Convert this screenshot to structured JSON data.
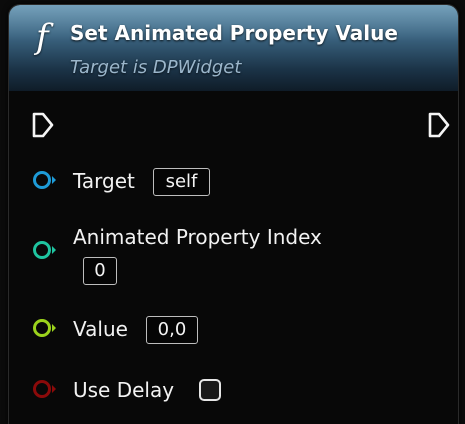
{
  "node": {
    "icon": "function-icon",
    "icon_glyph": "f",
    "title": "Set Animated Property Value",
    "subtitle": "Target is DPWidget",
    "header_color": "#3c6683"
  },
  "pins": {
    "exec_in": {
      "icon": "exec-input-pin-icon"
    },
    "exec_out": {
      "icon": "exec-output-pin-icon"
    },
    "target": {
      "label": "Target",
      "value": "self",
      "color": "#1e9bd7",
      "icon": "object-pin-icon"
    },
    "property_index": {
      "label": "Animated Property Index",
      "value": "0",
      "color": "#1fc4a0",
      "icon": "integer-pin-icon"
    },
    "value": {
      "label": "Value",
      "value": "0,0",
      "color": "#9bd31c",
      "icon": "float-pin-icon"
    },
    "use_delay": {
      "label": "Use Delay",
      "checked": false,
      "color": "#8b0a0a",
      "icon": "boolean-pin-icon"
    }
  }
}
